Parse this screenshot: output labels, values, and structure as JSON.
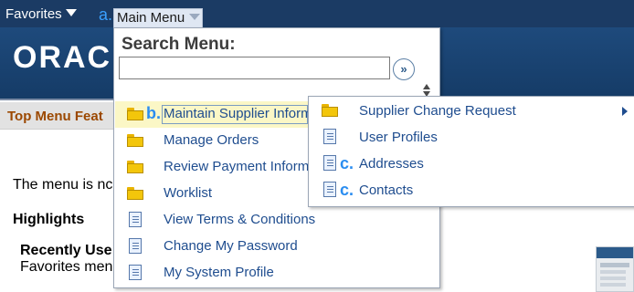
{
  "topbar": {
    "favorites_label": "Favorites",
    "main_menu_label": "Main Menu",
    "annotation_a": "a."
  },
  "header": {
    "logo_text": "ORAC"
  },
  "portal": {
    "title": "Top Menu Feat"
  },
  "body": {
    "menu_text": "The menu is nc",
    "highlights": "Highlights",
    "recently_used": "Recently Use",
    "favorites_text": "Favorites men"
  },
  "main_menu": {
    "title": "Search Menu:",
    "search_value": "",
    "go_symbol": "»",
    "items": [
      {
        "label": "Maintain Supplier Inform",
        "icon": "folder-icon",
        "annotation": "b."
      },
      {
        "label": "Manage Orders",
        "icon": "folder-icon"
      },
      {
        "label": "Review Payment Inform",
        "icon": "folder-icon"
      },
      {
        "label": "Worklist",
        "icon": "folder-icon"
      },
      {
        "label": "View Terms & Conditions",
        "icon": "document-icon"
      },
      {
        "label": "Change My Password",
        "icon": "document-icon"
      },
      {
        "label": "My System Profile",
        "icon": "document-icon"
      }
    ]
  },
  "submenu": {
    "items": [
      {
        "label": "Supplier Change Request",
        "icon": "folder-icon",
        "has_children": true
      },
      {
        "label": "User Profiles",
        "icon": "document-icon"
      },
      {
        "label": "Addresses",
        "icon": "document-icon",
        "annotation": "c."
      },
      {
        "label": "Contacts",
        "icon": "document-icon",
        "annotation": "c."
      }
    ]
  },
  "colors": {
    "topbar": "#1b3b64",
    "header": "#1e4a7c",
    "link": "#1f4d8f",
    "annotation": "#2a8df0",
    "highlight": "#fbf7c6",
    "portal_title": "#9b4800"
  }
}
